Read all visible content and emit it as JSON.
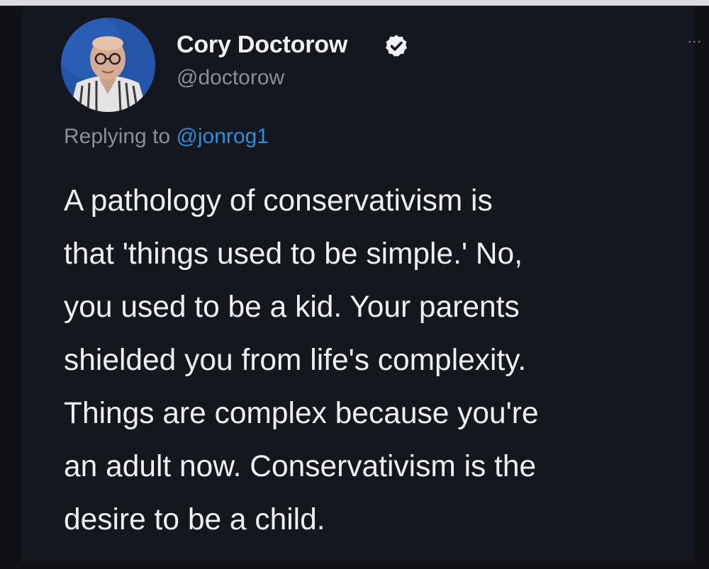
{
  "tweet": {
    "author_name": "Cory Doctorow",
    "author_handle": "@doctorow",
    "verified": true,
    "more_label": "···",
    "replying_prefix": "Replying to",
    "replying_handle": "@jonrog1",
    "text_lines": [
      "A pathology of conservativism is",
      "that 'things used to be simple.' No,",
      "you used to be a kid. Your parents",
      "shielded you from life's complexity.",
      "Things are complex because you're",
      "an adult now. Conservativism is the",
      "desire to be a child."
    ]
  },
  "colors": {
    "background": "#14171d",
    "text": "#eef0f1",
    "secondary": "#8b9096",
    "accent": "#2a8fe0",
    "avatar_bg": "#2555a8"
  },
  "icons": {
    "verified": "verified-badge-icon",
    "more": "more-options-icon"
  }
}
